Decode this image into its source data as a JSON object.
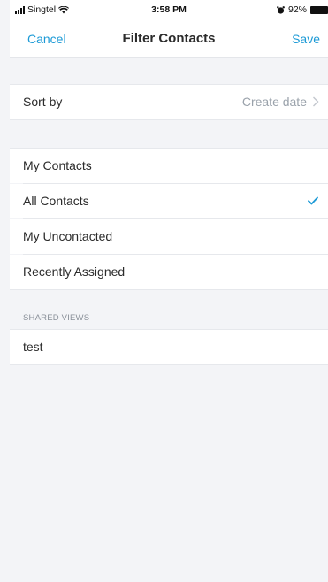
{
  "status_bar": {
    "carrier": "Singtel",
    "time": "3:58 PM",
    "battery": "92%"
  },
  "nav": {
    "cancel_label": "Cancel",
    "title": "Filter Contacts",
    "save_label": "Save"
  },
  "sort": {
    "label": "Sort by",
    "value": "Create date"
  },
  "views": {
    "items": [
      {
        "label": "My Contacts",
        "selected": false
      },
      {
        "label": "All Contacts",
        "selected": true
      },
      {
        "label": "My Uncontacted",
        "selected": false
      },
      {
        "label": "Recently Assigned",
        "selected": false
      }
    ]
  },
  "shared_views": {
    "header": "SHARED VIEWS",
    "items": [
      {
        "label": "test"
      }
    ]
  },
  "colors": {
    "accent": "#1c9ad6",
    "background": "#f3f4f7",
    "secondary_text": "#9aa2ab"
  }
}
